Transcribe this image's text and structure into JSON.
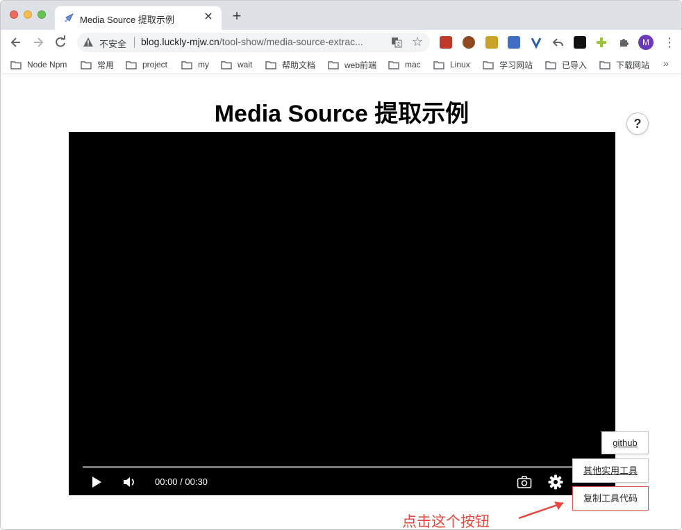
{
  "browser": {
    "tab_title": "Media Source 提取示例",
    "tab_close": "✕",
    "new_tab": "+",
    "security_label": "不安全",
    "url_host": "blog.luckly-mjw.cn",
    "url_path": "/tool-show/media-source-extrac...",
    "avatar_letter": "M"
  },
  "bookmarks": [
    {
      "label": "Node Npm"
    },
    {
      "label": "常用"
    },
    {
      "label": "project"
    },
    {
      "label": "my"
    },
    {
      "label": "wait"
    },
    {
      "label": "帮助文档"
    },
    {
      "label": "web前端"
    },
    {
      "label": "mac"
    },
    {
      "label": "Linux"
    },
    {
      "label": "学习网站"
    },
    {
      "label": "已导入"
    },
    {
      "label": "下载网站"
    }
  ],
  "bookmarks_more": "»",
  "page": {
    "title": "Media Source 提取示例",
    "help_label": "?"
  },
  "player": {
    "time": "00:00 / 00:30",
    "progress": 0
  },
  "buttons": {
    "github": "github",
    "tools": "其他实用工具",
    "copy": "复制工具代码"
  },
  "annotation": {
    "text": "点击这个按钮",
    "color": "#e8463c"
  }
}
